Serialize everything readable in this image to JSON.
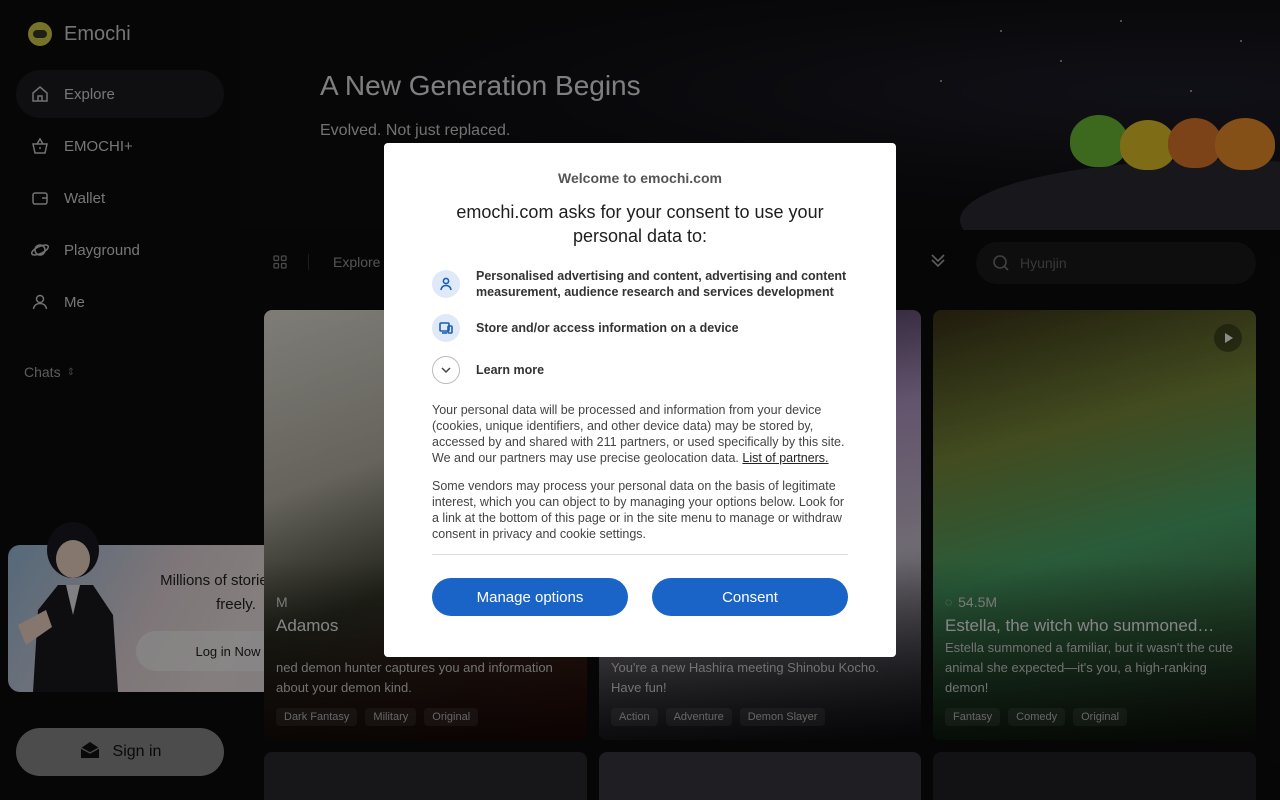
{
  "app": {
    "name": "Emochi"
  },
  "sidebar": {
    "items": [
      {
        "label": "Explore",
        "icon": "home-icon",
        "active": true
      },
      {
        "label": "EMOCHI+",
        "icon": "basket-icon",
        "active": false
      },
      {
        "label": "Wallet",
        "icon": "wallet-icon",
        "active": false
      },
      {
        "label": "Playground",
        "icon": "planet-icon",
        "active": false
      },
      {
        "label": "Me",
        "icon": "user-icon",
        "active": false
      }
    ],
    "chats_label": "Chats",
    "promo": {
      "text": "Millions of stories, chat freely.",
      "button": "Log in Now"
    },
    "signin_label": "Sign in"
  },
  "hero": {
    "title": "A New Generation Begins",
    "subtitle": "Evolved. Not just replaced."
  },
  "toolbar": {
    "explore_label": "Explore",
    "search_placeholder": "Hyunjin"
  },
  "cards": [
    {
      "stat": "M",
      "title": "Adamos",
      "desc": "ned demon hunter captures you and information about your demon kind.",
      "tags": [
        "Dark Fantasy",
        "Military",
        "Original"
      ]
    },
    {
      "stat": "",
      "title": "",
      "desc": "You're a new Hashira meeting Shinobu Kocho. Have fun!",
      "tags": [
        "Action",
        "Adventure",
        "Demon Slayer"
      ]
    },
    {
      "stat": "54.5M",
      "title": "Estella, the witch who summoned…",
      "desc": "Estella summoned a familiar, but it wasn't the cute animal she expected—it's you, a high-ranking demon!",
      "tags": [
        "Fantasy",
        "Comedy",
        "Original"
      ]
    }
  ],
  "consent": {
    "site": "Welcome to emochi.com",
    "heading": "emochi.com asks for your consent to use your personal data to:",
    "purposes": [
      {
        "icon": "person-icon",
        "text": "Personalised advertising and content, advertising and content measurement, audience research and services development"
      },
      {
        "icon": "device-icon",
        "text": "Store and/or access information on a device"
      }
    ],
    "learn_more": "Learn more",
    "body1": "Your personal data will be processed and information from your device (cookies, unique identifiers, and other device data) may be stored by, accessed by and shared with 211 partners, or used specifically by this site. We and our partners may use precise geolocation data. ",
    "partners_link": "List of partners.",
    "body2": "Some vendors may process your personal data on the basis of legitimate interest, which you can object to by managing your options below. Look for a link at the bottom of this page or in the site menu to manage or withdraw consent in privacy and cookie settings.",
    "manage_label": "Manage options",
    "consent_label": "Consent"
  },
  "colors": {
    "accent": "#1a64c8",
    "background": "#0c0c0e"
  }
}
